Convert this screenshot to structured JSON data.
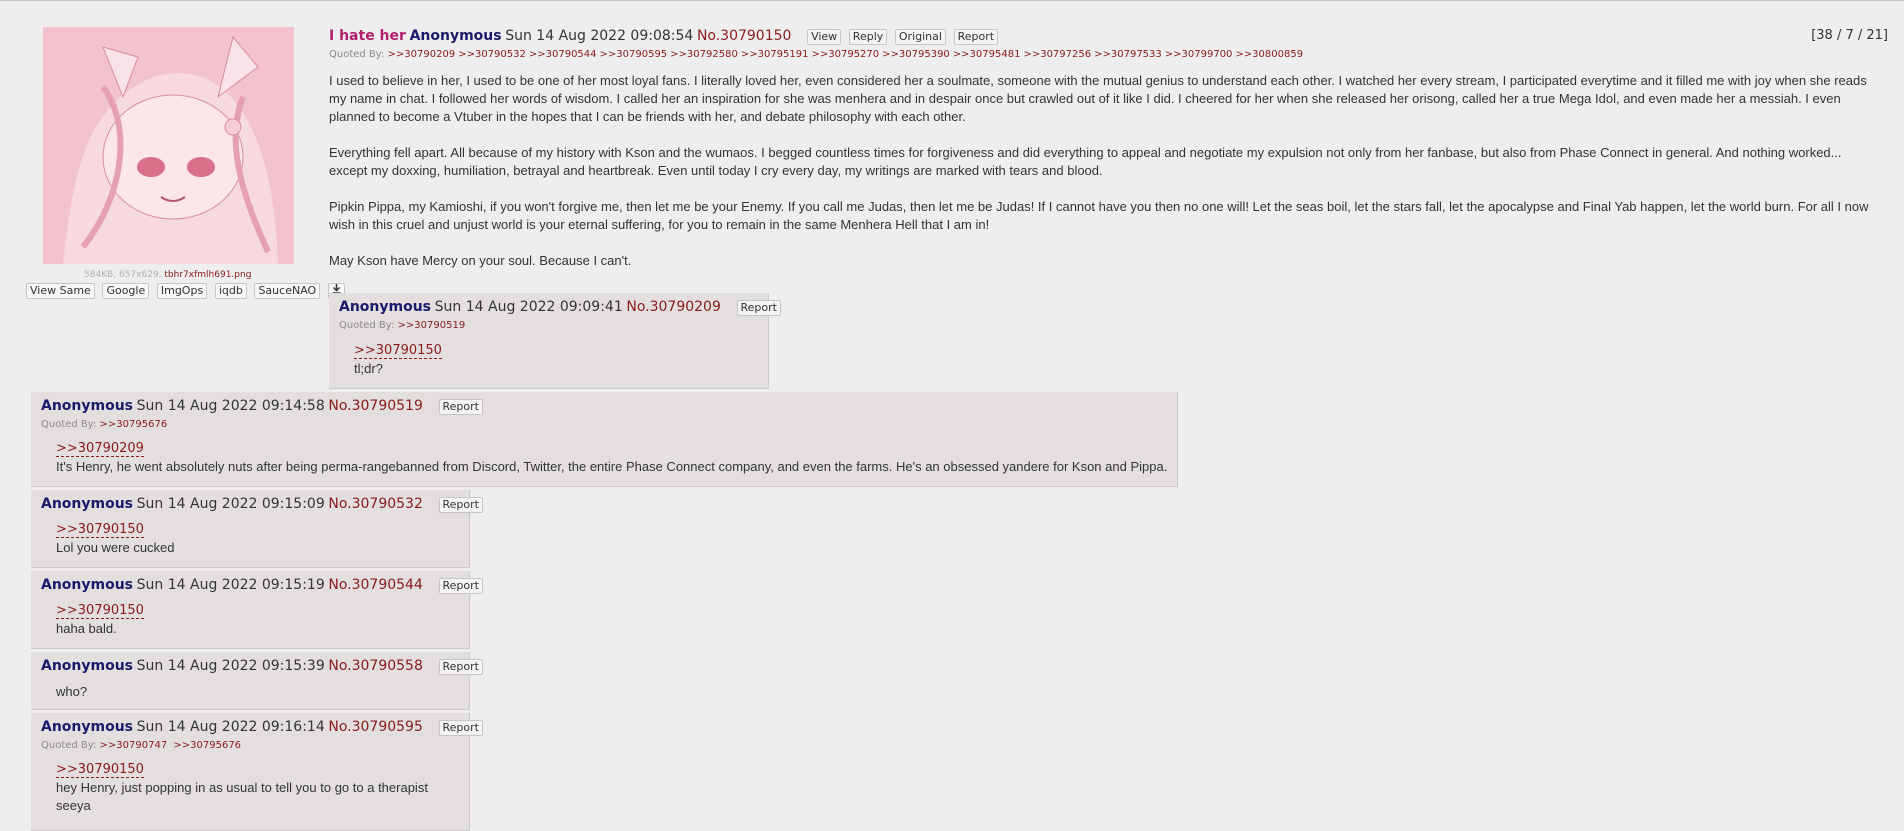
{
  "op": {
    "subject": "I hate her",
    "name": "Anonymous",
    "date": "Sun 14 Aug 2022 09:08:54",
    "number": "No.30790150",
    "buttons": [
      "View",
      "Reply",
      "Original",
      "Report"
    ],
    "stats": "[38 / 7 / 21]",
    "quoted_label": "Quoted By:",
    "quoted_by": [
      ">>30790209",
      ">>30790532",
      ">>30790544",
      ">>30790595",
      ">>30792580",
      ">>30795191",
      ">>30795270",
      ">>30795390",
      ">>30795481",
      ">>30797256",
      ">>30797533",
      ">>30799700",
      ">>30800859"
    ],
    "image_meta": "584KB, 657x629,",
    "image_filename": "tbhr7xfmlh691.png",
    "image_buttons": [
      "View Same",
      "Google",
      "ImgOps",
      "iqdb",
      "SauceNAO"
    ],
    "download_icon": "download-icon",
    "paragraphs": [
      "I used to believe in her, I used to be one of her most loyal fans. I literally loved her, even considered her a soulmate, someone with the mutual genius to understand each other. I watched her every stream, I participated everytime and it filled me with joy when she reads my name in chat. I followed her words of wisdom. I called her an inspiration for she was menhera and in despair once but crawled out of it like I did. I cheered for her when she released her orisong, called her a true Mega Idol, and even made her a messiah. I even planned to become a Vtuber in the hopes that I can be friends with her, and debate philosophy with each other.",
      "Everything fell apart. All because of my history with Kson and the wumaos. I begged countless times for forgiveness and did everything to appeal and negotiate my expulsion not only from her fanbase, but also from Phase Connect in general. And nothing worked... except my doxxing, humiliation, betrayal and heartbreak. Even until today I cry every day, my writings are marked with tears and blood.",
      "Pipkin Pippa, my Kamioshi, if you won't forgive me, then let me be your Enemy. If you call me Judas, then let me be Judas! If I cannot have you then no one will! Let the seas boil, let the stars fall, let the apocalypse and Final Yab happen, let the world burn. For all I now wish in this cruel and unjust world is your eternal suffering, for you to remain in the same Menhera Hell that I am in!",
      "May Kson have Mercy on your soul. Because I can't."
    ]
  },
  "replies": [
    {
      "name": "Anonymous",
      "date": "Sun 14 Aug 2022 09:09:41",
      "number": "No.30790209",
      "report": "Report",
      "quoted_label": "Quoted By:",
      "quoted_by": [
        ">>30790519"
      ],
      "quote": ">>30790150",
      "lines": [
        "tl;dr?"
      ]
    },
    {
      "name": "Anonymous",
      "date": "Sun 14 Aug 2022 09:14:58",
      "number": "No.30790519",
      "report": "Report",
      "quoted_label": "Quoted By:",
      "quoted_by": [
        ">>30795676"
      ],
      "quote": ">>30790209",
      "lines": [
        "It's Henry, he went absolutely nuts after being perma-rangebanned from Discord, Twitter, the entire Phase Connect company, and even the farms. He's an obsessed yandere for Kson and Pippa."
      ]
    },
    {
      "name": "Anonymous",
      "date": "Sun 14 Aug 2022 09:15:09",
      "number": "No.30790532",
      "report": "Report",
      "quote": ">>30790150",
      "lines": [
        "Lol you were cucked"
      ]
    },
    {
      "name": "Anonymous",
      "date": "Sun 14 Aug 2022 09:15:19",
      "number": "No.30790544",
      "report": "Report",
      "quote": ">>30790150",
      "lines": [
        "haha bald."
      ]
    },
    {
      "name": "Anonymous",
      "date": "Sun 14 Aug 2022 09:15:39",
      "number": "No.30790558",
      "report": "Report",
      "lines": [
        "who?"
      ]
    },
    {
      "name": "Anonymous",
      "date": "Sun 14 Aug 2022 09:16:14",
      "number": "No.30790595",
      "report": "Report",
      "quoted_label": "Quoted By:",
      "quoted_by": [
        ">>30790747",
        ">>30795676"
      ],
      "quote": ">>30790150",
      "lines": [
        "hey Henry, just popping in as usual to tell you to go to a therapist",
        "seeya"
      ]
    }
  ]
}
